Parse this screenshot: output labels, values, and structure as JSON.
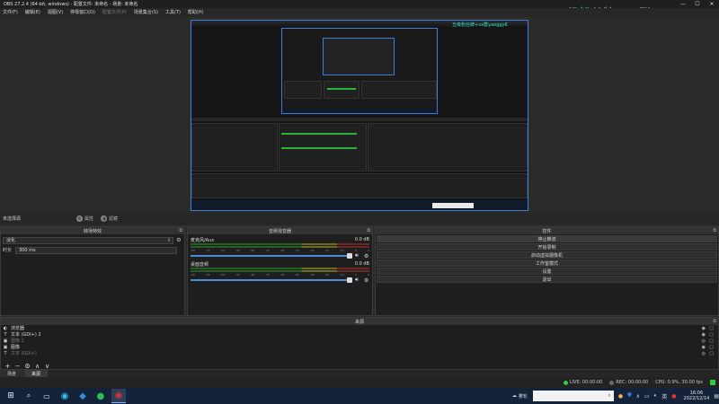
{
  "window": {
    "title": "OBS 27.2.4 (64-bit, windows) - 配置文件: 未命名 - 场景: 未命名"
  },
  "watermark": "五级粉丝牌+vx群yaoggy6",
  "menu": [
    "文件(F)",
    "编辑(E)",
    "视图(V)",
    "停靠窗口(D)",
    "配置文件(P)",
    "场景集合(S)",
    "工具(T)",
    "帮助(H)"
  ],
  "source_bar": {
    "selected": "未选择源",
    "properties": "属性",
    "filters": "滤镜"
  },
  "transitions": {
    "title": "转场特效",
    "current": "淡化",
    "duration_label": "时长",
    "duration_value": "300 ms"
  },
  "mixer": {
    "title": "音频混音器",
    "tracks": [
      {
        "name": "麦克风/Aux",
        "db": "0.0 dB"
      },
      {
        "name": "桌面音频",
        "db": "0.0 dB"
      }
    ],
    "ticks": [
      "-60",
      "-55",
      "-50",
      "-45",
      "-40",
      "-35",
      "-30",
      "-25",
      "-20",
      "-15",
      "-10",
      "-5",
      "0"
    ]
  },
  "controls": {
    "title": "控件",
    "buttons": [
      "停止推流",
      "开始录制",
      "启动虚拟摄像机",
      "工作室模式",
      "设置",
      "退出"
    ]
  },
  "sources": {
    "title": "来源",
    "items": [
      {
        "icon": "browser-icon",
        "glyph": "◐",
        "label": "浏览器",
        "dim": false
      },
      {
        "icon": "text-icon",
        "glyph": "T",
        "label": "文本 (GDI+) 2",
        "dim": false
      },
      {
        "icon": "image-icon",
        "glyph": "▣",
        "label": "图像 2",
        "dim": true
      },
      {
        "icon": "image-icon",
        "glyph": "▣",
        "label": "图像",
        "dim": false
      },
      {
        "icon": "text-icon",
        "glyph": "T",
        "label": "文本 (GDI+)",
        "dim": true
      }
    ],
    "toolbar": [
      "+",
      "−",
      "⚙",
      "∧",
      "∨"
    ]
  },
  "bottom_tabs": [
    "场景",
    "来源"
  ],
  "status": {
    "live": "LIVE: 00:00:00",
    "rec": "REC: 00:00:00",
    "cpu": "CPU: 0.9%, 30.00 fps",
    "live_color": "#2ecc40",
    "rec_color": "#6c6c6c"
  },
  "taskbar": {
    "weather": "雾轮",
    "time": "16:06",
    "date": "2022/12/14"
  },
  "nested": {
    "watermark": "五级粉丝牌+vx群yaoggy6"
  }
}
